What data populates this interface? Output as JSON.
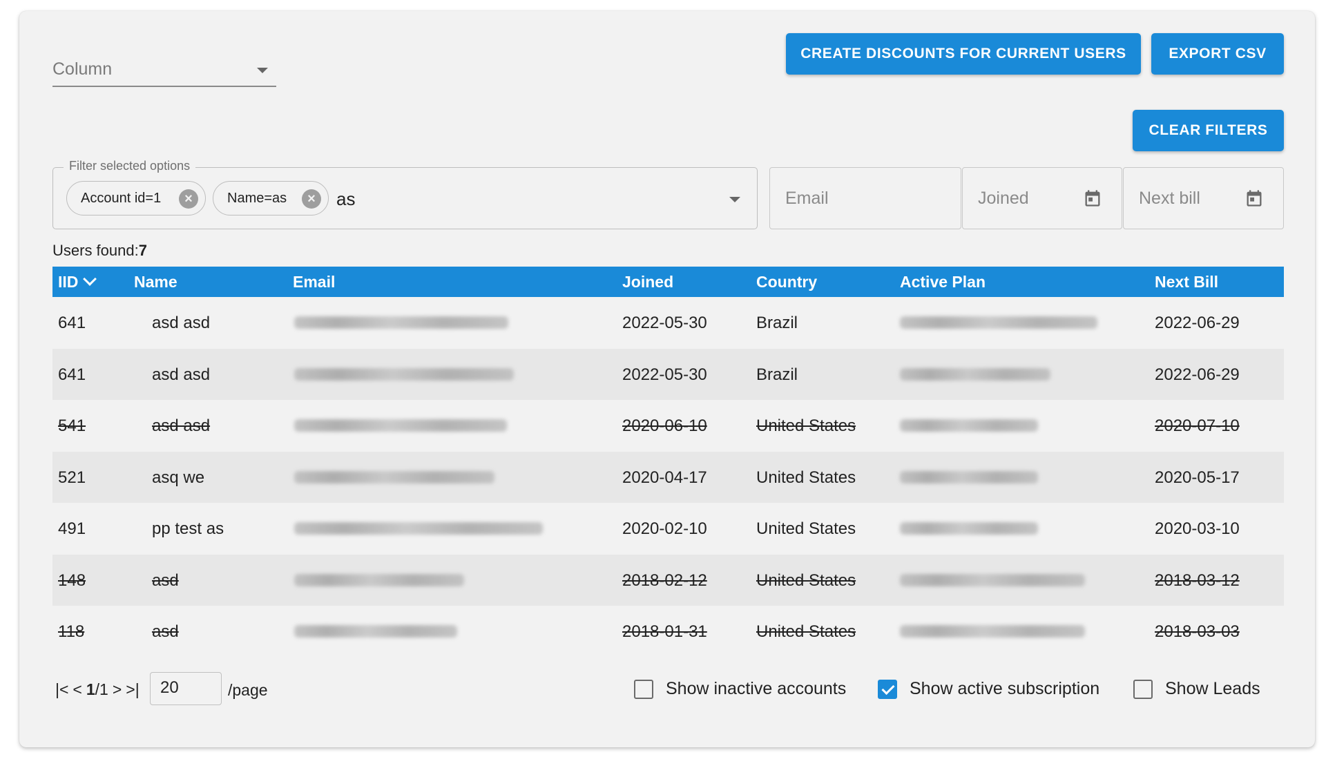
{
  "column_select": {
    "label": "Column"
  },
  "buttons": {
    "create_discounts": "CREATE DISCOUNTS FOR CURRENT USERS",
    "export_csv": "EXPORT CSV",
    "clear_filters": "CLEAR FILTERS"
  },
  "filter": {
    "legend": "Filter selected options",
    "chips": [
      "Account id=1",
      "Name=as"
    ],
    "input_value": "as"
  },
  "fields": {
    "email_placeholder": "Email",
    "joined_placeholder": "Joined",
    "next_bill_placeholder": "Next bill"
  },
  "users_found": {
    "label": "Users found:",
    "count": "7"
  },
  "table": {
    "headers": [
      "IID",
      "Name",
      "Email",
      "Joined",
      "Country",
      "Active Plan",
      "Next Bill"
    ],
    "sort": {
      "column": "IID",
      "direction": "descending"
    },
    "rows": [
      {
        "iid": "641",
        "name": "asd asd",
        "joined": "2022-05-30",
        "country": "Brazil",
        "next_bill": "2022-06-29",
        "inactive": false
      },
      {
        "iid": "641",
        "name": "asd asd",
        "joined": "2022-05-30",
        "country": "Brazil",
        "next_bill": "2022-06-29",
        "inactive": false
      },
      {
        "iid": "541",
        "name": "asd asd",
        "joined": "2020-06-10",
        "country": "United States",
        "next_bill": "2020-07-10",
        "inactive": true
      },
      {
        "iid": "521",
        "name": "asq we",
        "joined": "2020-04-17",
        "country": "United States",
        "next_bill": "2020-05-17",
        "inactive": false
      },
      {
        "iid": "491",
        "name": "pp test as",
        "joined": "2020-02-10",
        "country": "United States",
        "next_bill": "2020-03-10",
        "inactive": false
      },
      {
        "iid": "148",
        "name": "asd",
        "joined": "2018-02-12",
        "country": "United States",
        "next_bill": "2018-03-12",
        "inactive": true
      },
      {
        "iid": "118",
        "name": "asd",
        "joined": "2018-01-31",
        "country": "United States",
        "next_bill": "2018-03-03",
        "inactive": true
      }
    ]
  },
  "pager": {
    "first": "|<",
    "prev": "<",
    "current": "1",
    "sep": "/",
    "total": "1",
    "next": ">",
    "last": ">|",
    "page_size": "20",
    "per_page_label": "/page"
  },
  "checkboxes": [
    {
      "label": "Show inactive accounts",
      "checked": false
    },
    {
      "label": "Show active subscription",
      "checked": true
    },
    {
      "label": "Show Leads",
      "checked": false
    }
  ],
  "colors": {
    "primary": "#1a8ad8",
    "background": "#f2f2f2",
    "row_alt": "#e7e7e7"
  }
}
